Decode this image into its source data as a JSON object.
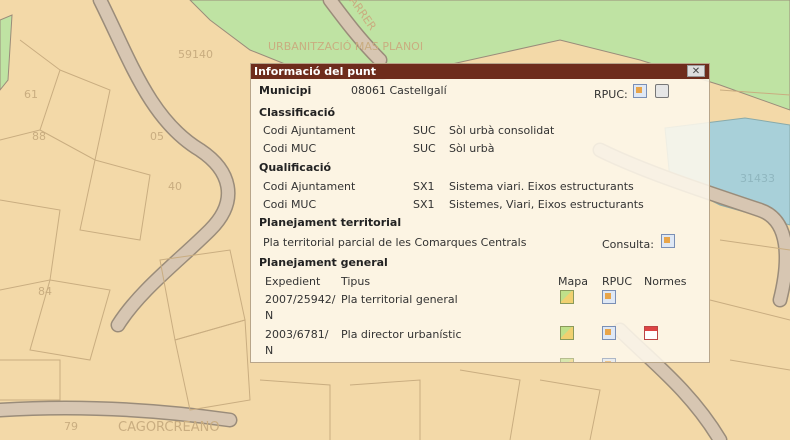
{
  "map": {
    "labels": {
      "urbanitzacio": "URBANITZACIÓ MAS PLANOI",
      "block_left": "59140",
      "block_right": "31433",
      "place_bottom": "CAGORCREANO",
      "road_top": "CARRER",
      "n1": "61",
      "n2": "88",
      "n3": "05",
      "n4": "40",
      "n5": "84",
      "n6": "79"
    },
    "colors": {
      "parcel": "#f3d9a8",
      "road": "#d7c6b2",
      "green": "#bfe3a3",
      "water": "#a8d0d9",
      "outline": "#9a8c7a"
    }
  },
  "popup": {
    "title": "Informació del punt",
    "close_label": "✕",
    "municipi": {
      "label": "Municipi",
      "value": "08061 Castellgalí"
    },
    "rpuc_label": "RPUC:",
    "classificacio": {
      "heading": "Classificació",
      "rows": [
        {
          "label": "Codi Ajuntament",
          "code": "SUC",
          "desc": "Sòl urbà consolidat"
        },
        {
          "label": "Codi MUC",
          "code": "SUC",
          "desc": "Sòl urbà"
        }
      ]
    },
    "qualificacio": {
      "heading": "Qualificació",
      "rows": [
        {
          "label": "Codi Ajuntament",
          "code": "SX1",
          "desc": "Sistema viari. Eixos estructurants"
        },
        {
          "label": "Codi MUC",
          "code": "SX1",
          "desc": "Sistemes, Viari, Eixos estructurants"
        }
      ]
    },
    "territorial": {
      "heading": "Planejament territorial",
      "plan": "Pla territorial parcial de les Comarques Centrals",
      "consulta_label": "Consulta:"
    },
    "general": {
      "heading": "Planejament general",
      "columns": {
        "expedient": "Expedient",
        "tipus": "Tipus",
        "mapa": "Mapa",
        "rpuc": "RPUC",
        "normes": "Normes"
      },
      "rows": [
        {
          "expedient_line1": "2007/25942/",
          "expedient_line2": "N",
          "tipus": "Pla territorial general"
        },
        {
          "expedient_line1": "2003/6781/",
          "expedient_line2": "N",
          "tipus": "Pla director urbanístic"
        }
      ]
    }
  }
}
